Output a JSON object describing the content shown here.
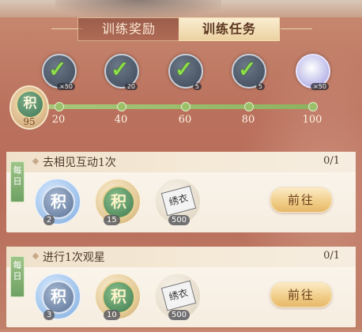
{
  "tabs": [
    {
      "label": "训练奖励",
      "active": false
    },
    {
      "label": "训练任务",
      "active": true
    }
  ],
  "progress": {
    "current_points": "95",
    "points_icon_char": "积",
    "fill_fraction": 1.0,
    "milestones": [
      {
        "label": "20",
        "claimed": true,
        "count": "×50",
        "icon": "claimed-chest-icon"
      },
      {
        "label": "40",
        "claimed": true,
        "count": "20",
        "icon": "claimed-reward-icon"
      },
      {
        "label": "60",
        "claimed": true,
        "count": "5",
        "icon": "claimed-quill-icon"
      },
      {
        "label": "80",
        "claimed": true,
        "count": "5",
        "icon": "claimed-gift-icon"
      },
      {
        "label": "100",
        "claimed": false,
        "count": "×50",
        "icon": "swirl-orb-icon"
      }
    ]
  },
  "tasks": [
    {
      "tag": "每日",
      "title": "去相见互动1次",
      "progress": "0/1",
      "button": "前往",
      "rewards": [
        {
          "type": "silver-coin",
          "char": "积",
          "qty": "2"
        },
        {
          "type": "green-coin",
          "char": "积",
          "qty": "15"
        },
        {
          "type": "scroll",
          "char": "绣衣",
          "qty": "500"
        }
      ]
    },
    {
      "tag": "每日",
      "title": "进行1次观星",
      "progress": "0/1",
      "button": "前往",
      "rewards": [
        {
          "type": "silver-coin",
          "char": "积",
          "qty": "3"
        },
        {
          "type": "green-coin",
          "char": "积",
          "qty": "10"
        },
        {
          "type": "scroll",
          "char": "绣衣",
          "qty": "500"
        }
      ]
    }
  ]
}
